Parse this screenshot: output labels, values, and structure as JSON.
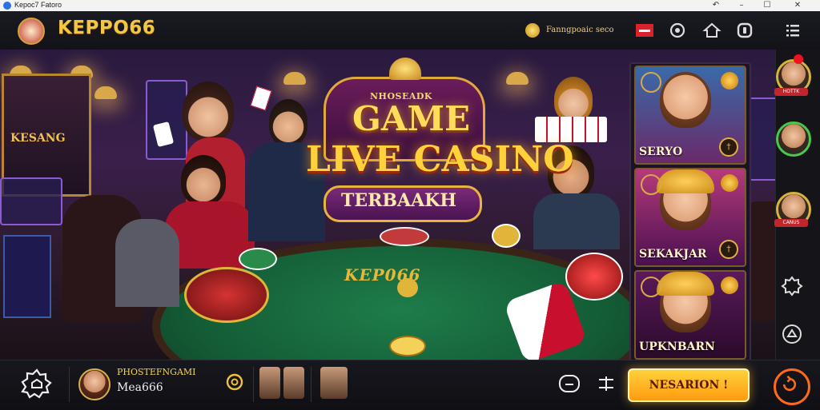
{
  "window": {
    "title": "Kepoc7 Fatoro"
  },
  "header": {
    "brand": "KEPPO66",
    "coin_label": "Fanngpoaic seco"
  },
  "hero": {
    "subtitle": "NHOSEADK",
    "line1": "GAME",
    "line2": "LIVE CASINO",
    "line3": "TERBAAKH",
    "sign_left": "KESANG",
    "table_logo": "KEP066"
  },
  "cards": [
    {
      "name": "SERYO"
    },
    {
      "name": "SEKAKJAR"
    },
    {
      "name": "UPKNBARN"
    }
  ],
  "rail": {
    "tags": [
      "HOTTK",
      "",
      "CANUS"
    ]
  },
  "bottom": {
    "player_line1": "PHOSTEFNGAMI",
    "player_line2": "Mea666",
    "register_label": "NESARION !"
  },
  "colors": {
    "accent": "#f3c742",
    "register": "#ffb21e",
    "felt": "#1e7d4a"
  }
}
